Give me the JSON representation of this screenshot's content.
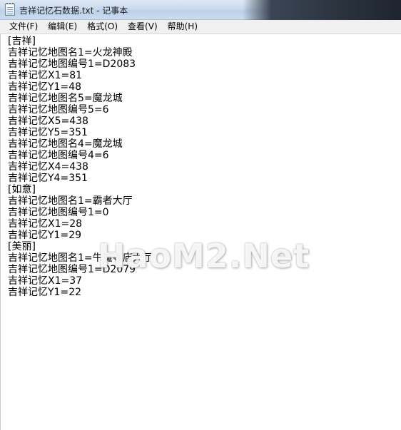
{
  "window": {
    "title": "吉祥记忆石数据.txt - 记事本"
  },
  "menu": {
    "items": [
      "文件(F)",
      "编辑(E)",
      "格式(O)",
      "查看(V)",
      "帮助(H)"
    ]
  },
  "document": {
    "lines": [
      "[吉祥]",
      "吉祥记忆地图名1=火龙神殿",
      "吉祥记忆地图编号1=D2083",
      "吉祥记忆X1=81",
      "吉祥记忆Y1=48",
      "吉祥记忆地图名5=魔龙城",
      "吉祥记忆地图编号5=6",
      "吉祥记忆X5=438",
      "吉祥记忆Y5=351",
      "吉祥记忆地图名4=魔龙城",
      "吉祥记忆地图编号4=6",
      "吉祥记忆X4=438",
      "吉祥记忆Y4=351",
      "[如意]",
      "吉祥记忆地图名1=霸者大厅",
      "吉祥记忆地图编号1=0",
      "吉祥记忆X1=28",
      "吉祥记忆Y1=29",
      "[美丽]",
      "吉祥记忆地图名1=牛魔寺庙大厅",
      "吉祥记忆地图编号1=D2079",
      "吉祥记忆X1=37",
      "吉祥记忆Y1=22"
    ]
  },
  "watermark": {
    "text": "HaoM2.Net"
  }
}
